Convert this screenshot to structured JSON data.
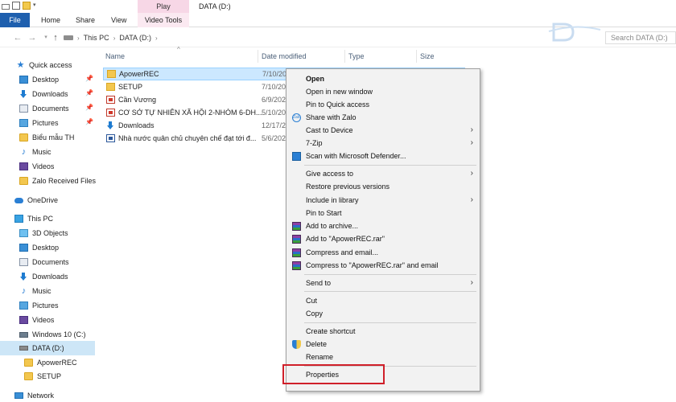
{
  "window": {
    "title": "DATA (D:)",
    "play_label": "Play"
  },
  "ribbon": {
    "tabs": [
      "File",
      "Home",
      "Share",
      "View",
      "Video Tools"
    ]
  },
  "address": {
    "path": [
      "This PC",
      "DATA (D:)"
    ],
    "search_placeholder": "Search DATA (D:)"
  },
  "nav": {
    "quick_access": "Quick access",
    "quick_items": [
      "Desktop",
      "Downloads",
      "Documents",
      "Pictures",
      "Biểu mẫu TH",
      "Music",
      "Videos",
      "Zalo Received Files"
    ],
    "onedrive": "OneDrive",
    "this_pc": "This PC",
    "pc_items": [
      "3D Objects",
      "Desktop",
      "Documents",
      "Downloads",
      "Music",
      "Pictures",
      "Videos",
      "Windows 10 (C:)",
      "DATA (D:)"
    ],
    "data_children": [
      "ApowerREC",
      "SETUP"
    ],
    "network": "Network"
  },
  "files": {
    "columns": [
      "Name",
      "Date modified",
      "Type",
      "Size"
    ],
    "rows": [
      {
        "name": "ApowerREC",
        "date": "7/10/20",
        "icon": "folder-icon"
      },
      {
        "name": "SETUP",
        "date": "7/10/20",
        "icon": "folder-icon"
      },
      {
        "name": "Cần Vương",
        "date": "6/9/202",
        "icon": "pdf-file-icon"
      },
      {
        "name": "CƠ SỞ TỰ NHIÊN XÃ HỘI 2-NHÓM 6-DH...",
        "date": "5/10/20",
        "icon": "pdf-file-icon"
      },
      {
        "name": "Downloads",
        "date": "12/17/2",
        "icon": "downloads-folder-icon"
      },
      {
        "name": "Nhà nước quân chủ chuyên chế đạt tới đ...",
        "date": "5/6/202",
        "icon": "word-file-icon"
      }
    ]
  },
  "context_menu": {
    "items": {
      "open": "Open",
      "open_new_window": "Open in new window",
      "pin_quick_access": "Pin to Quick access",
      "share_zalo": "Share with Zalo",
      "cast": "Cast to Device",
      "zip": "7-Zip",
      "scan": "Scan with Microsoft Defender...",
      "give_access": "Give access to",
      "restore": "Restore previous versions",
      "include_library": "Include in library",
      "pin_start": "Pin to Start",
      "add_archive": "Add to archive...",
      "add_rar": "Add to \"ApowerREC.rar\"",
      "compress_email": "Compress and email...",
      "compress_rar_email": "Compress to \"ApowerREC.rar\" and email",
      "send_to": "Send to",
      "cut": "Cut",
      "copy": "Copy",
      "create_shortcut": "Create shortcut",
      "delete": "Delete",
      "rename": "Rename",
      "properties": "Properties"
    }
  },
  "colors": {
    "file_tab": "#1e5fae",
    "selection": "#cce8ff",
    "highlight_box": "#d0202a"
  }
}
